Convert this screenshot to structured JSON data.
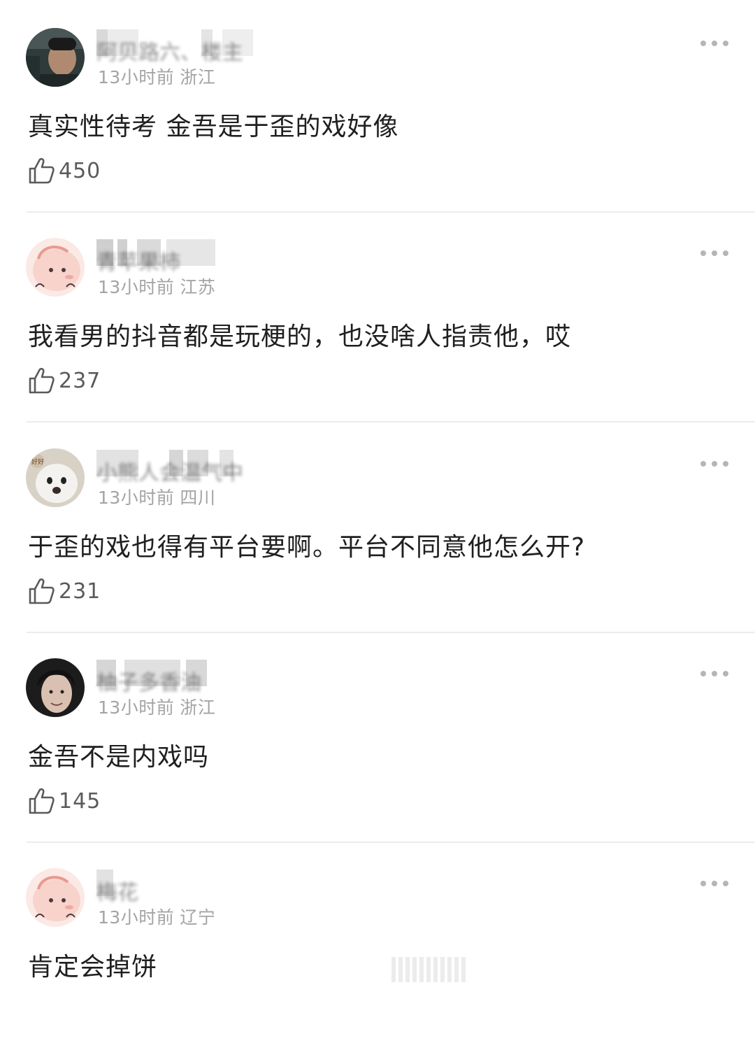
{
  "comments": [
    {
      "username": "阿贝路六、楼主",
      "time": "13小时前",
      "location": "浙江",
      "text": "真实性待考 金吾是于歪的戏好像",
      "likes": "450",
      "avatar_icon": "avatar-man-photo"
    },
    {
      "username": "青苹果柿",
      "time": "13小时前",
      "location": "江苏",
      "text": "我看男的抖音都是玩梗的，也没啥人指责他，哎",
      "likes": "237",
      "avatar_icon": "avatar-pink-cartoon"
    },
    {
      "username": "小熊人会温气中",
      "time": "13小时前",
      "location": "四川",
      "text": "于歪的戏也得有平台要啊。平台不同意他怎么开?",
      "likes": "231",
      "avatar_icon": "avatar-white-dog"
    },
    {
      "username": "柚子多香油",
      "time": "13小时前",
      "location": "浙江",
      "text": "金吾不是内戏吗",
      "likes": "145",
      "avatar_icon": "avatar-woman-photo"
    },
    {
      "username": "梅花",
      "time": "13小时前",
      "location": "辽宁",
      "text": "肯定会掉饼",
      "likes": "",
      "avatar_icon": "avatar-pink-cartoon"
    }
  ],
  "icons": {
    "like": "thumbs-up-outline-icon",
    "more": "more-dots-icon"
  },
  "colors": {
    "meta_gray": "#a4a4a4",
    "divider": "#ececec",
    "icon_gray": "#b5b5b5"
  }
}
